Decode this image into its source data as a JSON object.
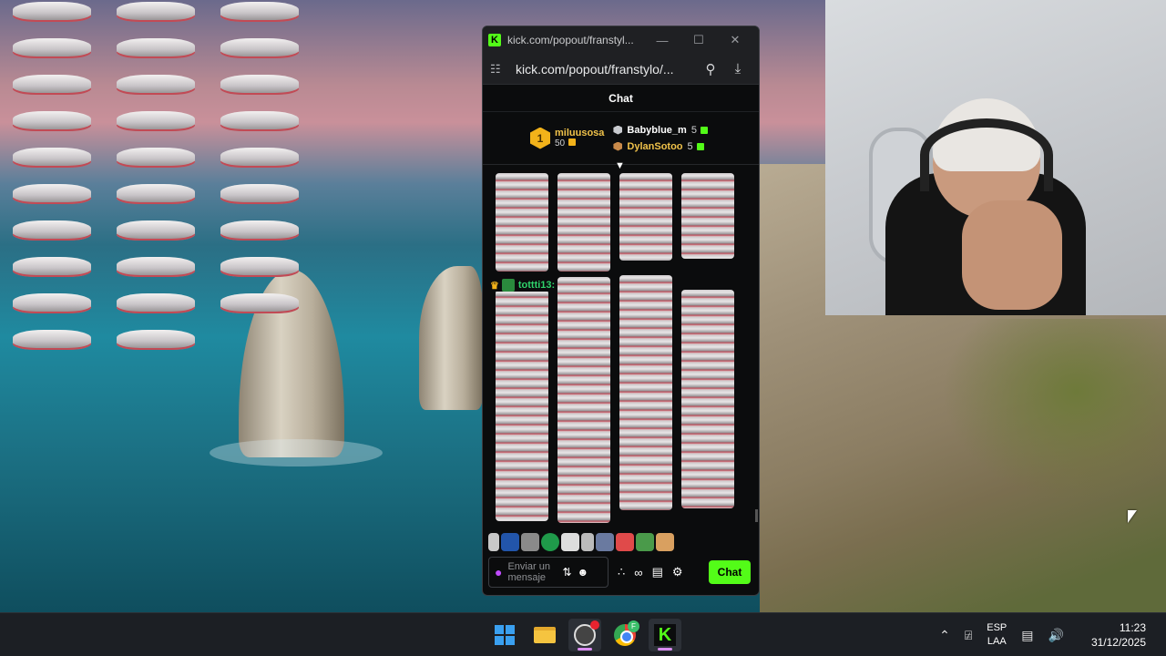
{
  "browser": {
    "tab_title": "kick.com/popout/franstyl...",
    "url": "kick.com/popout/franstylo/...",
    "minimize_glyph": "—",
    "maximize_glyph": "☐",
    "close_glyph": "✕"
  },
  "chat": {
    "header": "Chat",
    "leaderboard": {
      "first": {
        "rank": "1",
        "name": "miluusosa",
        "score": "50"
      },
      "others": [
        {
          "name": "Babyblue_m",
          "score": "5",
          "color": "#ffffff"
        },
        {
          "name": "DylanSotoo",
          "score": "5",
          "color": "#f0c24a"
        }
      ]
    },
    "message_user": "tottti13:",
    "input_placeholder": "Enviar un mensaje",
    "send_label": "Chat"
  },
  "taskbar": {
    "language_top": "ESP",
    "language_bottom": "LAA",
    "time": "11:23",
    "date": "31/12/2025",
    "chrome_badge": "F",
    "kick_letter": "K"
  },
  "colors": {
    "kick_green": "#53fc18",
    "gold": "#f2b21a",
    "username_green": "#2fd36b"
  },
  "icons": [
    "search-icon",
    "download-icon",
    "site-settings-icon",
    "mic-icon",
    "emoji-icon",
    "settings-icon",
    "store-icon",
    "windows-start-icon",
    "file-explorer-icon",
    "obs-icon",
    "chrome-icon",
    "kick-icon",
    "chevron-up-icon",
    "volume-icon",
    "network-icon"
  ]
}
